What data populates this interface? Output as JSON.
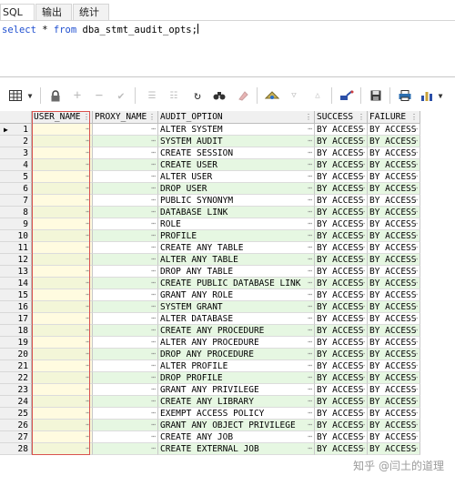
{
  "tabs": [
    {
      "label": "SQL",
      "active": true
    },
    {
      "label": "输出",
      "active": false
    },
    {
      "label": "统计",
      "active": false
    }
  ],
  "editor": {
    "kw1": "select",
    "star": " * ",
    "kw2": "from",
    "rest": " dba_stmt_audit_opts;"
  },
  "grid": {
    "columns": [
      "USER_NAME",
      "PROXY_NAME",
      "AUDIT_OPTION",
      "SUCCESS",
      "FAILURE"
    ],
    "rows": [
      {
        "n": "1",
        "audit_option": "ALTER SYSTEM",
        "success": "BY ACCESS",
        "failure": "BY ACCESS"
      },
      {
        "n": "2",
        "audit_option": "SYSTEM AUDIT",
        "success": "BY ACCESS",
        "failure": "BY ACCESS"
      },
      {
        "n": "3",
        "audit_option": "CREATE SESSION",
        "success": "BY ACCESS",
        "failure": "BY ACCESS"
      },
      {
        "n": "4",
        "audit_option": "CREATE USER",
        "success": "BY ACCESS",
        "failure": "BY ACCESS"
      },
      {
        "n": "5",
        "audit_option": "ALTER USER",
        "success": "BY ACCESS",
        "failure": "BY ACCESS"
      },
      {
        "n": "6",
        "audit_option": "DROP USER",
        "success": "BY ACCESS",
        "failure": "BY ACCESS"
      },
      {
        "n": "7",
        "audit_option": "PUBLIC SYNONYM",
        "success": "BY ACCESS",
        "failure": "BY ACCESS"
      },
      {
        "n": "8",
        "audit_option": "DATABASE LINK",
        "success": "BY ACCESS",
        "failure": "BY ACCESS"
      },
      {
        "n": "9",
        "audit_option": "ROLE",
        "success": "BY ACCESS",
        "failure": "BY ACCESS"
      },
      {
        "n": "10",
        "audit_option": "PROFILE",
        "success": "BY ACCESS",
        "failure": "BY ACCESS"
      },
      {
        "n": "11",
        "audit_option": "CREATE ANY TABLE",
        "success": "BY ACCESS",
        "failure": "BY ACCESS"
      },
      {
        "n": "12",
        "audit_option": "ALTER ANY TABLE",
        "success": "BY ACCESS",
        "failure": "BY ACCESS"
      },
      {
        "n": "13",
        "audit_option": "DROP ANY TABLE",
        "success": "BY ACCESS",
        "failure": "BY ACCESS"
      },
      {
        "n": "14",
        "audit_option": "CREATE PUBLIC DATABASE LINK",
        "success": "BY ACCESS",
        "failure": "BY ACCESS"
      },
      {
        "n": "15",
        "audit_option": "GRANT ANY ROLE",
        "success": "BY ACCESS",
        "failure": "BY ACCESS"
      },
      {
        "n": "16",
        "audit_option": "SYSTEM GRANT",
        "success": "BY ACCESS",
        "failure": "BY ACCESS"
      },
      {
        "n": "17",
        "audit_option": "ALTER DATABASE",
        "success": "BY ACCESS",
        "failure": "BY ACCESS"
      },
      {
        "n": "18",
        "audit_option": "CREATE ANY PROCEDURE",
        "success": "BY ACCESS",
        "failure": "BY ACCESS"
      },
      {
        "n": "19",
        "audit_option": "ALTER ANY PROCEDURE",
        "success": "BY ACCESS",
        "failure": "BY ACCESS"
      },
      {
        "n": "20",
        "audit_option": "DROP ANY PROCEDURE",
        "success": "BY ACCESS",
        "failure": "BY ACCESS"
      },
      {
        "n": "21",
        "audit_option": "ALTER PROFILE",
        "success": "BY ACCESS",
        "failure": "BY ACCESS"
      },
      {
        "n": "22",
        "audit_option": "DROP PROFILE",
        "success": "BY ACCESS",
        "failure": "BY ACCESS"
      },
      {
        "n": "23",
        "audit_option": "GRANT ANY PRIVILEGE",
        "success": "BY ACCESS",
        "failure": "BY ACCESS"
      },
      {
        "n": "24",
        "audit_option": "CREATE ANY LIBRARY",
        "success": "BY ACCESS",
        "failure": "BY ACCESS"
      },
      {
        "n": "25",
        "audit_option": "EXEMPT ACCESS POLICY",
        "success": "BY ACCESS",
        "failure": "BY ACCESS"
      },
      {
        "n": "26",
        "audit_option": "GRANT ANY OBJECT PRIVILEGE",
        "success": "BY ACCESS",
        "failure": "BY ACCESS"
      },
      {
        "n": "27",
        "audit_option": "CREATE ANY JOB",
        "success": "BY ACCESS",
        "failure": "BY ACCESS"
      },
      {
        "n": "28",
        "audit_option": "CREATE EXTERNAL JOB",
        "success": "BY ACCESS",
        "failure": "BY ACCESS"
      }
    ]
  },
  "toolbar": {
    "icons": [
      "grid-view-icon",
      "dropdown-arrow-icon",
      "lock-icon",
      "add-record-icon",
      "delete-record-icon",
      "post-changes-icon",
      "filter-icon",
      "clear-filter-icon",
      "refresh-icon",
      "find-icon",
      "clear-icon",
      "query-by-example-icon",
      "next-page-icon",
      "previous-page-icon",
      "export-icon",
      "save-icon",
      "print-icon",
      "chart-icon"
    ]
  },
  "colors": {
    "even_row": "#e6f7e2",
    "keyword": "#1f4fd0",
    "selection_border": "#d9534f"
  },
  "watermark": "知乎 @闫土的道理"
}
